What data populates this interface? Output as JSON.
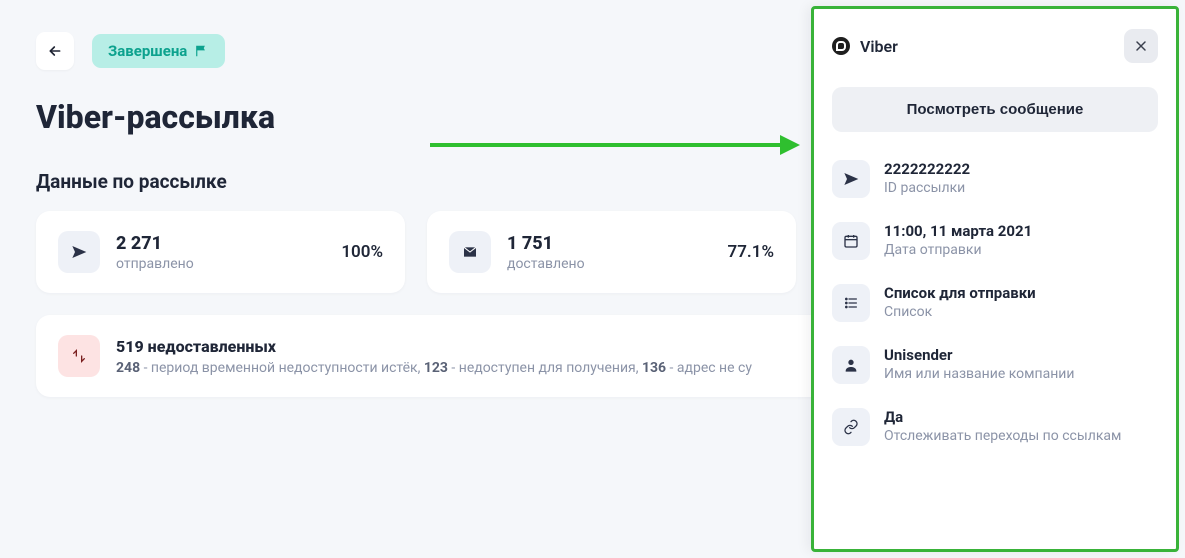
{
  "header": {
    "status_label": "Завершена",
    "page_title": "Viber-рассылка"
  },
  "section_title": "Данные по рассылке",
  "stats": {
    "sent": {
      "value": "2 271",
      "label": "отправлено",
      "pct": "100%"
    },
    "delivered": {
      "value": "1 751",
      "label": "доставлено",
      "pct": "77.1%"
    }
  },
  "failures": {
    "count": "519",
    "title_suffix": "недоставленных",
    "parts": [
      {
        "n": "248",
        "txt": " - период временной недоступности истёк, "
      },
      {
        "n": "123",
        "txt": " - недоступен для получения, "
      },
      {
        "n": "136",
        "txt": " - адрес не су"
      }
    ]
  },
  "panel": {
    "brand": "Viber",
    "view_message": "Посмотреть сообщение",
    "items": [
      {
        "value": "2222222222",
        "label": "ID рассылки"
      },
      {
        "value": "11:00, 11 марта 2021",
        "label": "Дата отправки"
      },
      {
        "value": "Список для отправки",
        "label": "Список"
      },
      {
        "value": "Unisender",
        "label": "Имя или название компании"
      },
      {
        "value": "Да",
        "label": "Отслеживать переходы по ссылкам"
      }
    ]
  }
}
